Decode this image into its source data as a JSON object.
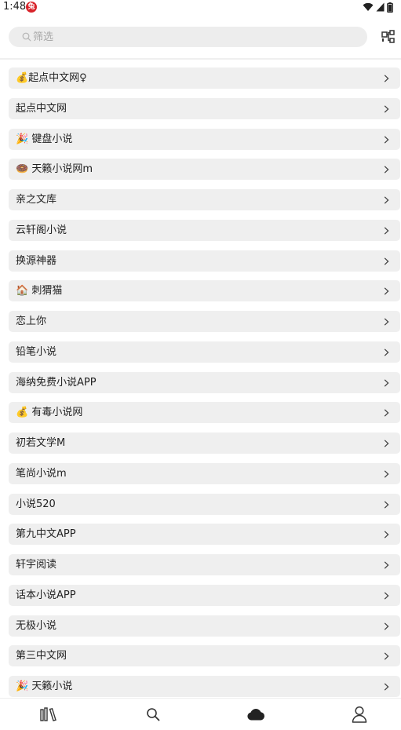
{
  "status_bar": {
    "time": "1:48",
    "notification_icon": "app-notification-icon",
    "icons": [
      "wifi-icon",
      "signal-icon",
      "battery-icon"
    ]
  },
  "search": {
    "placeholder": "筛选",
    "value": ""
  },
  "sources": [
    {
      "label": "💰起点中文网♀"
    },
    {
      "label": "起点中文网"
    },
    {
      "label": "🎉 键盘小说"
    },
    {
      "label": "🍩 天籁小说网m"
    },
    {
      "label": "亲之文库"
    },
    {
      "label": "云轩阁小说"
    },
    {
      "label": "换源神器"
    },
    {
      "label": "🏠 刺猬猫"
    },
    {
      "label": "恋上你"
    },
    {
      "label": "铅笔小说"
    },
    {
      "label": "海纳免费小说APP"
    },
    {
      "label": "💰 有毒小说网"
    },
    {
      "label": "初若文学M"
    },
    {
      "label": "笔尚小说m"
    },
    {
      "label": "小说520"
    },
    {
      "label": "第九中文APP"
    },
    {
      "label": "轩宇阅读"
    },
    {
      "label": "话本小说APP"
    },
    {
      "label": "无极小说"
    },
    {
      "label": "第三中文网"
    },
    {
      "label": "🎉 天籁小说"
    }
  ],
  "bottom_nav": {
    "items": [
      "bookshelf-icon",
      "search-icon",
      "cloud-icon",
      "profile-icon"
    ],
    "active": "cloud-icon"
  },
  "colors": {
    "item_background": "#efefef",
    "search_background": "#ededed",
    "placeholder": "#a8a8a8",
    "text": "#222222",
    "notification": "#d8232a"
  }
}
